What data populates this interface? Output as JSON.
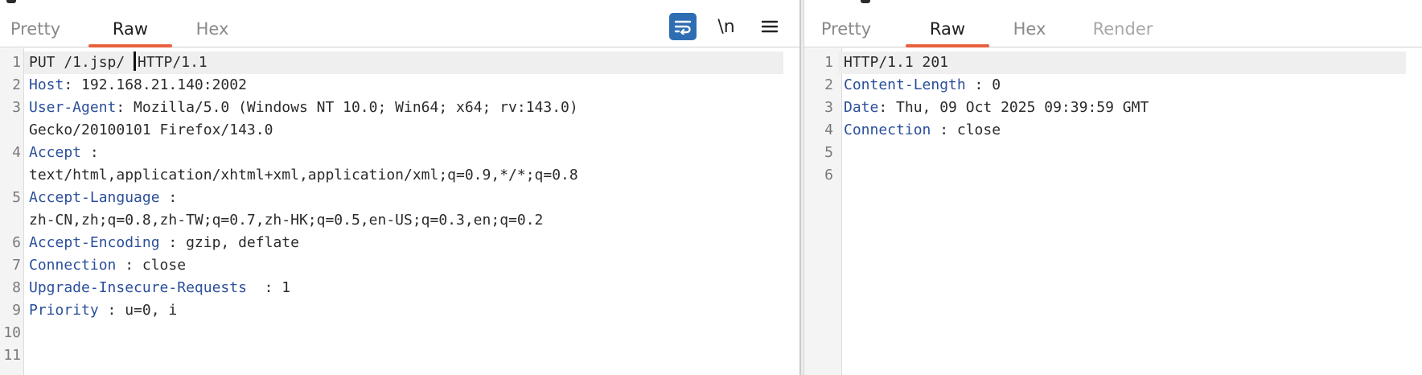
{
  "request": {
    "tabs": [
      "Pretty",
      "Raw",
      "Hex"
    ],
    "active_tab": "Raw",
    "toolbar": {
      "wrap_icon": "wrap-lines-icon",
      "newline_label": "\\n",
      "menu_icon": "hamburger-menu-icon"
    },
    "lines": [
      {
        "n": "1",
        "a": "PUT /1.jsp/ ",
        "b": "HTTP/1.1"
      },
      {
        "n": "2",
        "h": "Host",
        "v": ": 192.168.21.140:2002"
      },
      {
        "n": "3",
        "h": "User-Agent",
        "v": ": Mozilla/5.0 (Windows NT 10.0; Win64; x64; rv:143.0)"
      },
      {
        "n": "",
        "t": "Gecko/20100101 Firefox/143.0"
      },
      {
        "n": "4",
        "h": "Accept",
        "v": " :"
      },
      {
        "n": "",
        "t": "text/html,application/xhtml+xml,application/xml;q=0.9,*/*;q=0.8"
      },
      {
        "n": "5",
        "h": "Accept-Language",
        "v": " :"
      },
      {
        "n": "",
        "t": "zh-CN,zh;q=0.8,zh-TW;q=0.7,zh-HK;q=0.5,en-US;q=0.3,en;q=0.2"
      },
      {
        "n": "6",
        "h": "Accept-Encoding",
        "v": " : gzip, deflate"
      },
      {
        "n": "7",
        "h": "Connection",
        "v": " : close"
      },
      {
        "n": "8",
        "h": "Upgrade-Insecure-Requests",
        "v": "  : 1"
      },
      {
        "n": "9",
        "h": "Priority",
        "v": " : u=0, i"
      },
      {
        "n": "10",
        "t": ""
      },
      {
        "n": "11",
        "t": ""
      }
    ]
  },
  "response": {
    "tabs": [
      "Pretty",
      "Raw",
      "Hex",
      "Render"
    ],
    "active_tab": "Raw",
    "lines": [
      {
        "n": "1",
        "t": "HTTP/1.1 201"
      },
      {
        "n": "2",
        "h": "Content-Length",
        "v": " : 0"
      },
      {
        "n": "3",
        "h": "Date",
        "v": ": Thu, 09 Oct 2025 09:39:59 GMT"
      },
      {
        "n": "4",
        "h": "Connection",
        "v": " : close"
      },
      {
        "n": "5",
        "t": ""
      },
      {
        "n": "6",
        "t": ""
      }
    ]
  },
  "colors": {
    "accent_tab_underline": "#e8613f",
    "header_name": "#2b4f9b",
    "wrap_button_bg": "#2f6db3"
  }
}
